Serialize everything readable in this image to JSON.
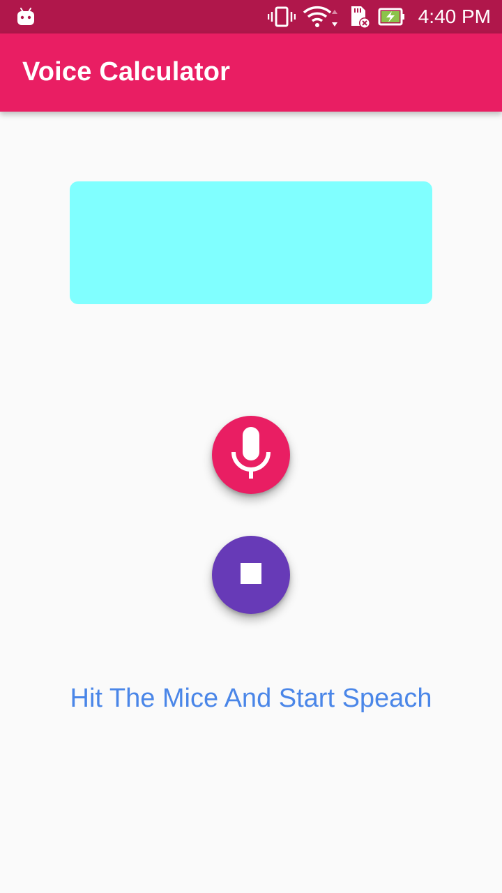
{
  "status_bar": {
    "time": "4:40 PM",
    "icons": [
      "android-icon",
      "vibrate-icon",
      "wifi-icon",
      "sd-card-icon",
      "battery-charging-icon"
    ]
  },
  "app_bar": {
    "title": "Voice Calculator"
  },
  "result_box": {
    "value": ""
  },
  "controls": {
    "mic_icon": "mic-icon",
    "stop_icon": "stop-icon"
  },
  "hint": "Hit The Mice And Start Speach",
  "colors": {
    "status_bar": "#b0174b",
    "app_bar": "#e91e63",
    "result_box": "#80ffff",
    "mic_button": "#e91e63",
    "stop_button": "#673ab7",
    "hint_text": "#4a86e8",
    "background": "#fafafa"
  }
}
